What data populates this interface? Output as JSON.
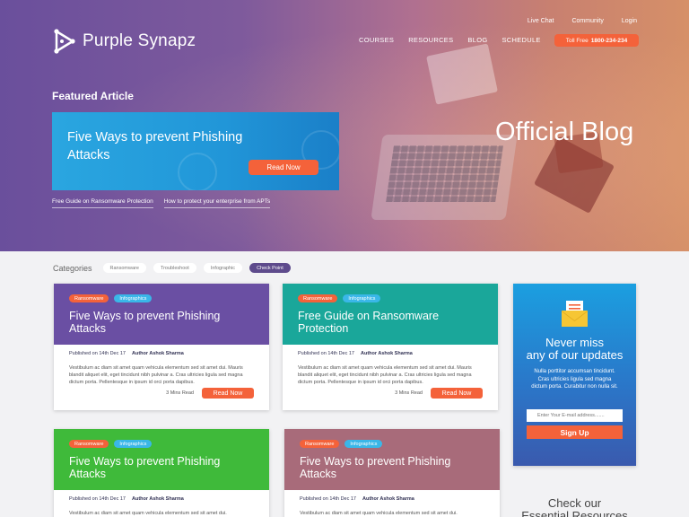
{
  "brand": {
    "name": "Purple Synapz"
  },
  "topnav": {
    "live_chat": "Live Chat",
    "community": "Community",
    "login": "Login"
  },
  "mainnav": {
    "courses": "COURSES",
    "resources": "RESOURCES",
    "blog": "BLOG",
    "schedule": "SCHEDULE",
    "toll_free_label": "Toll Free",
    "toll_free_number": "1800-234-234"
  },
  "hero": {
    "featured_label": "Featured Article",
    "feature_title": "Five Ways to prevent Phishing Attacks",
    "feature_button": "Read Now",
    "links": [
      "Free Guide on Ransomware Protection",
      "How to protect your enterprise from APTs"
    ],
    "official_blog": "Official Blog"
  },
  "categories": {
    "label": "Categories",
    "chips": [
      "Ransomware",
      "Troubleshoot",
      "Infographic",
      "Check Point"
    ],
    "active": "Check Point"
  },
  "cards": [
    {
      "tags": [
        "Ransomware",
        "Infographics"
      ],
      "title": "Five Ways to prevent Phishing Attacks",
      "published": "Published on 14th Dec 17",
      "author": "Author Ashok Sharma",
      "excerpt": "Vestibulum ac diam sit amet quam vehicula elementum sed sit amet dui. Mauris blandit aliquet elit, eget tincidunt nibh pulvinar a. Cras ultricies ligula sed magna dictum porta. Pellentesque in ipsum id orci porta dapibus.",
      "read_time": "3 Mins Read",
      "button": "Read Now",
      "color": "#6a4fa3"
    },
    {
      "tags": [
        "Ransomware",
        "Infographics"
      ],
      "title": "Free Guide on Ransomware Protection",
      "published": "Published on 14th Dec 17",
      "author": "Author Ashok Sharma",
      "excerpt": "Vestibulum ac diam sit amet quam vehicula elementum sed sit amet dui. Mauris blandit aliquet elit, eget tincidunt nibh pulvinar a. Cras ultricies ligula sed magna dictum porta. Pellentesque in ipsum id orci porta dapibus.",
      "read_time": "3 Mins Read",
      "button": "Read Now",
      "color": "#1aa79a"
    },
    {
      "tags": [
        "Ransomware",
        "Infographics"
      ],
      "title": "Five Ways to prevent Phishing Attacks",
      "published": "Published on 14th Dec 17",
      "author": "Author Ashok Sharma",
      "excerpt": "Vestibulum ac diam sit amet quam vehicula elementum sed sit amet dui.",
      "color": "#3fba3a"
    },
    {
      "tags": [
        "Ransomware",
        "Infographics"
      ],
      "title": "Five Ways to prevent Phishing Attacks",
      "published": "Published on 14th Dec 17",
      "author": "Author Ashok Sharma",
      "excerpt": "Vestibulum ac diam sit amet quam vehicula elementum sed sit amet dui.",
      "color": "#a86b7a"
    }
  ],
  "subscribe": {
    "title_line1": "Never miss",
    "title_line2": "any of our updates",
    "text": "Nulla porttitor accumsan tincidunt. Cras ultricies ligula sed magna dictum porta. Curabitur non nulla sit.",
    "email_placeholder": "Enter Your E-mail address.......",
    "button": "Sign Up"
  },
  "essential": {
    "line1": "Check our",
    "line2": "Essential Resources"
  },
  "colors": {
    "accent": "#f4623a",
    "brand": "#5e4b8c"
  }
}
